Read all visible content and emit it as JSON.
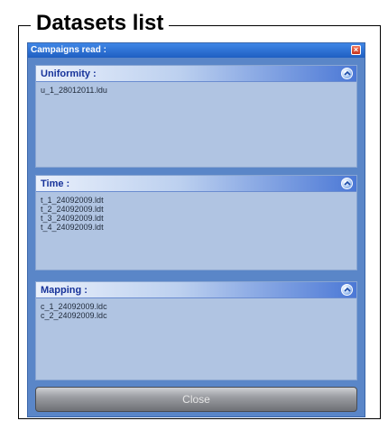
{
  "frame": {
    "title": "Datasets list"
  },
  "dialog": {
    "title": "Campaigns read :",
    "close_glyph": "×",
    "panels": [
      {
        "title": "Uniformity :",
        "items": [
          "u_1_28012011.ldu"
        ]
      },
      {
        "title": "Time :",
        "items": [
          "t_1_24092009.ldt",
          "t_2_24092009.ldt",
          "t_3_24092009.ldt",
          "t_4_24092009.ldt"
        ]
      },
      {
        "title": "Mapping :",
        "items": [
          "c_1_24092009.ldc",
          "c_2_24092009.ldc"
        ]
      }
    ],
    "close_button_label": "Close"
  },
  "colors": {
    "titlebar": "#1f5fc2",
    "panel_header_accent": "#4b78d6",
    "panel_body": "#b0c4e2",
    "panel_title_text": "#17339a"
  },
  "icons": {
    "collapse": "chevron-up-icon",
    "window_close": "close-icon"
  }
}
